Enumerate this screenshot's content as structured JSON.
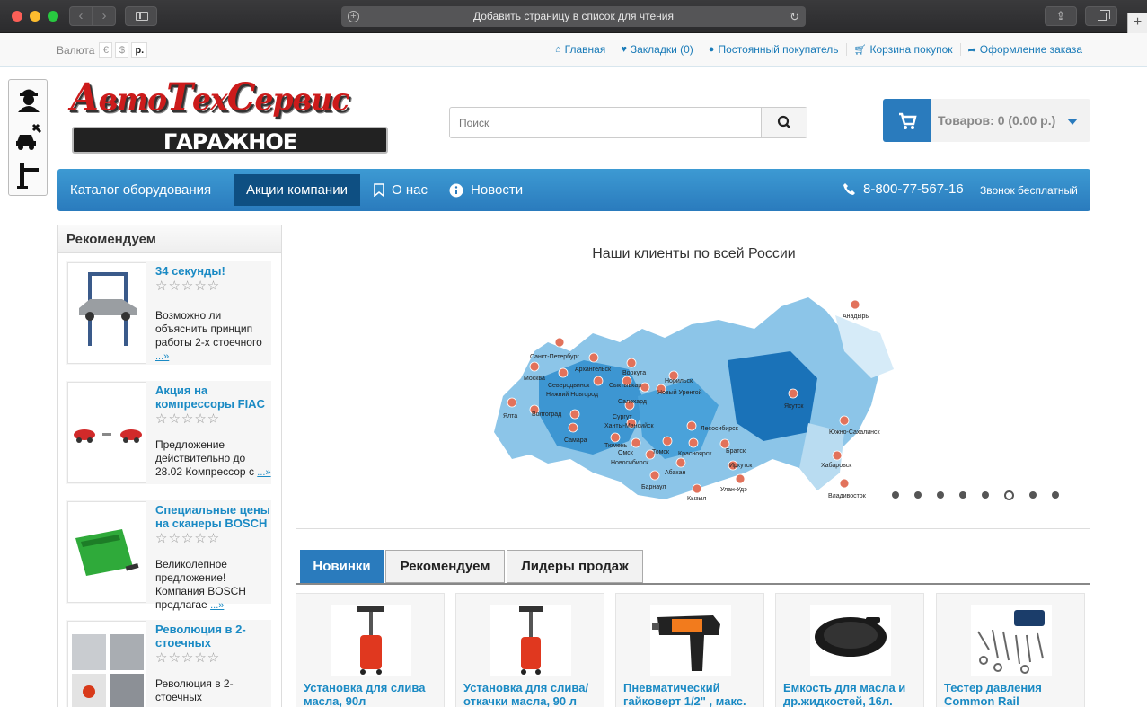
{
  "browser": {
    "url_text": "Добавить страницу в список для чтения"
  },
  "topbar": {
    "currency_label": "Валюта",
    "currencies": [
      "€",
      "$",
      "р."
    ],
    "links": [
      "Главная",
      "Закладки (0)",
      "Постоянный покупатель",
      "Корзина покупок",
      "Оформление заказа"
    ]
  },
  "logo": {
    "line1_a": "А",
    "line1_b": "вто",
    "line1_c": "Т",
    "line1_d": "ех",
    "line1_e": "С",
    "line1_f": "ервис",
    "line2": "ГАРАЖНОЕ ОБОРУДОВАНИЕ"
  },
  "search": {
    "placeholder": "Поиск"
  },
  "cart": {
    "label": "Товаров: 0 (0.00 р.)"
  },
  "nav": {
    "items": [
      "Каталог оборудования",
      "Акции компании",
      "О нас",
      "Новости"
    ],
    "phone": "8-800-77-567-16",
    "phone_note": "Звонок бесплатный"
  },
  "recommended": {
    "title": "Рекомендуем",
    "items": [
      {
        "title": "34 секунды!",
        "desc": "Возможно ли объяснить принцип работы 2-х стоечного",
        "more": "...»"
      },
      {
        "title": "Акция на компрессоры FIAC",
        "desc": "Предложение действительно до 28.02 Компрессор с",
        "more": "...»"
      },
      {
        "title": "Специальные цены на сканеры BOSCH",
        "desc": "Великолепное предложение! Компания BOSCH предлагае",
        "more": "...»"
      },
      {
        "title": "Революция в 2-стоечных",
        "desc": "Революция в 2-стоечных",
        "more": ""
      }
    ]
  },
  "map": {
    "title": "Наши клиенты по всей России",
    "cities": [
      "Анадырь",
      "Санкт-Петербург",
      "Архангельск",
      "Воркута",
      "Москва",
      "Северодвинск",
      "Сыктывкар",
      "Норильск",
      "Нижний Новгород",
      "Салехард",
      "Новый Уренгой",
      "Якутск",
      "Ялта",
      "Волгоград",
      "Сургут",
      "Ханты-Мансийск",
      "Лесосибирск",
      "Южно-Сахалинск",
      "Самара",
      "Тюмень",
      "Омск",
      "Томск",
      "Красноярск",
      "Братск",
      "Новосибирск",
      "Иркутск",
      "Хабаровск",
      "Абакан",
      "Барнаул",
      "Кызыл",
      "Улан-Удэ",
      "Владивосток"
    ],
    "slides_count": 8,
    "active_slide": 6
  },
  "product_tabs": [
    "Новинки",
    "Рекомендуем",
    "Лидеры продаж"
  ],
  "products": [
    {
      "name": "Установка для слива масла, 90л"
    },
    {
      "name": "Установка для слива/откачки масла, 90 л"
    },
    {
      "name": "Пневматический гайковерт 1/2\" , макс."
    },
    {
      "name": "Емкость для масла и др.жидкостей, 16л."
    },
    {
      "name": "Тестер давления Common Rail"
    }
  ],
  "colors": {
    "accent": "#2a7bbd",
    "link": "#1a8ac4",
    "nav_active": "#0e4f82",
    "pin": "#e2725b"
  }
}
